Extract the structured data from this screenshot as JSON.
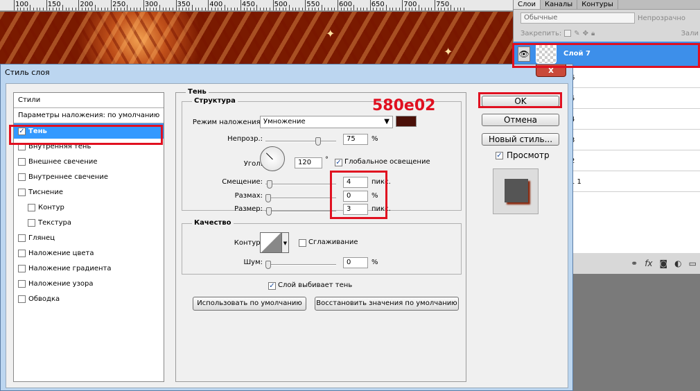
{
  "ruler": {
    "numbers": [
      "100",
      "150",
      "200",
      "250",
      "300",
      "350",
      "400",
      "450",
      "500",
      "550",
      "600",
      "650",
      "700",
      "750"
    ]
  },
  "layers_panel": {
    "tabs": [
      "Слои",
      "Каналы",
      "Контуры"
    ],
    "blend_mode": "Обычные",
    "opacity_label": "Непрозрачно",
    "lock_label": "Закрепить:",
    "fill_label": "Зали",
    "selected_layer": "Слой 7",
    "layers": [
      "6",
      "5",
      "4",
      "3",
      "2",
      "1 1"
    ],
    "bottom_icons": [
      "link-icon",
      "fx-icon",
      "mask-icon",
      "adjustment-icon",
      "folder-icon"
    ]
  },
  "dialog": {
    "title": "Стиль слоя",
    "close_label": "x",
    "styles_header": "Стили",
    "blend_defaults": "Параметры наложения: по умолчанию",
    "styles": [
      {
        "label": "Тень",
        "checked": true,
        "selected": true,
        "sub": false
      },
      {
        "label": "Внутренняя тень",
        "checked": false,
        "selected": false,
        "sub": false
      },
      {
        "label": "Внешнее свечение",
        "checked": false,
        "selected": false,
        "sub": false
      },
      {
        "label": "Внутреннее свечение",
        "checked": false,
        "selected": false,
        "sub": false
      },
      {
        "label": "Тиснение",
        "checked": false,
        "selected": false,
        "sub": false
      },
      {
        "label": "Контур",
        "checked": false,
        "selected": false,
        "sub": true
      },
      {
        "label": "Текстура",
        "checked": false,
        "selected": false,
        "sub": true
      },
      {
        "label": "Глянец",
        "checked": false,
        "selected": false,
        "sub": false
      },
      {
        "label": "Наложение цвета",
        "checked": false,
        "selected": false,
        "sub": false
      },
      {
        "label": "Наложение градиента",
        "checked": false,
        "selected": false,
        "sub": false
      },
      {
        "label": "Наложение узора",
        "checked": false,
        "selected": false,
        "sub": false
      },
      {
        "label": "Обводка",
        "checked": false,
        "selected": false,
        "sub": false
      }
    ],
    "shadow": {
      "title": "Тень",
      "structure_title": "Структура",
      "blend_mode_label": "Режим наложения:",
      "blend_mode_value": "Умножение",
      "shadow_color": "#4a1008",
      "opacity_label": "Непрозр.:",
      "opacity_value": "75",
      "percent": "%",
      "angle_label": "Угол:",
      "angle_value": "120",
      "degree": "°",
      "global_light_label": "Глобальное освещение",
      "global_light_checked": true,
      "distance_label": "Смещение:",
      "distance_value": "4",
      "spread_label": "Размах:",
      "spread_value": "0",
      "size_label": "Размер:",
      "size_value": "3",
      "px_unit": "пикс.",
      "quality_title": "Качество",
      "contour_label": "Контур:",
      "antialias_label": "Сглаживание",
      "noise_label": "Шум:",
      "noise_value": "0",
      "knockout_label": "Слой выбивает тень",
      "knockout_checked": true,
      "make_default_btn": "Использовать по умолчанию",
      "reset_default_btn": "Восстановить значения по умолчанию"
    },
    "buttons": {
      "ok": "OK",
      "cancel": "Отмена",
      "new_style": "Новый стиль...",
      "preview_label": "Просмотр",
      "preview_checked": true
    }
  },
  "annotation": {
    "code": "580e02",
    "color": "#e01020"
  }
}
